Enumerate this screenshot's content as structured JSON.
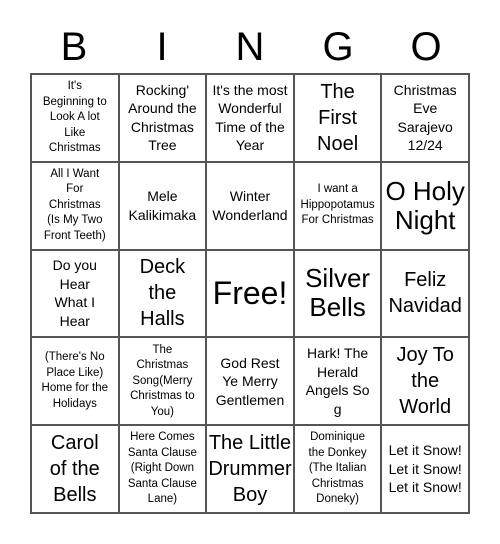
{
  "header": [
    "B",
    "I",
    "N",
    "G",
    "O"
  ],
  "cells": [
    {
      "text": "It's\nBeginning to\nLook A lot\nLike\nChristmas",
      "size": "s"
    },
    {
      "text": "Rocking'\nAround the\nChristmas\nTree",
      "size": "m"
    },
    {
      "text": "It's the most\nWonderful\nTime of the\nYear",
      "size": "m"
    },
    {
      "text": "The\nFirst\nNoel",
      "size": "l"
    },
    {
      "text": "Christmas\nEve\nSarajevo\n12/24",
      "size": "m"
    },
    {
      "text": "All I Want\nFor\nChristmas\n(Is My Two\nFront Teeth)",
      "size": "s"
    },
    {
      "text": "Mele\nKalikimaka",
      "size": "m"
    },
    {
      "text": "Winter\nWonderland",
      "size": "m"
    },
    {
      "text": "I want a\nHippopotamus\nFor Christmas",
      "size": "s"
    },
    {
      "text": "O Holy\nNight",
      "size": "xl"
    },
    {
      "text": "Do you\nHear\nWhat I\nHear",
      "size": "m"
    },
    {
      "text": "Deck\nthe\nHalls",
      "size": "l"
    },
    {
      "text": "Free!",
      "size": "xxl"
    },
    {
      "text": "Silver\nBells",
      "size": "xl"
    },
    {
      "text": "Feliz\nNavidad",
      "size": "l"
    },
    {
      "text": "(There's No\nPlace Like)\nHome for the\nHolidays",
      "size": "s"
    },
    {
      "text": "The\nChristmas\nSong(Merry\nChristmas to\nYou)",
      "size": "s"
    },
    {
      "text": "God Rest\nYe Merry\nGentlemen",
      "size": "m"
    },
    {
      "text": "Hark! The\nHerald\nAngels So\ng",
      "size": "m"
    },
    {
      "text": "Joy To\nthe\nWorld",
      "size": "l"
    },
    {
      "text": "Carol\nof the\nBells",
      "size": "l"
    },
    {
      "text": "Here Comes\nSanta Clause\n(Right Down\nSanta Clause\nLane)",
      "size": "s"
    },
    {
      "text": "The Little\nDrummer\nBoy",
      "size": "l"
    },
    {
      "text": "Dominique\nthe Donkey\n(The Italian\nChristmas\nDoneky)",
      "size": "s"
    },
    {
      "text": "Let it Snow!\nLet it Snow!\nLet it Snow!",
      "size": "m"
    }
  ]
}
